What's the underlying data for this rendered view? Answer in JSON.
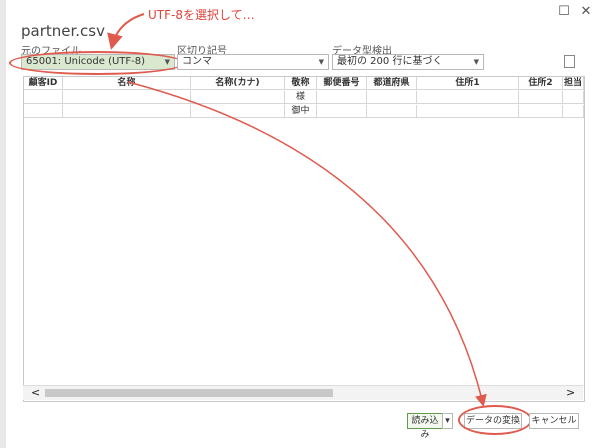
{
  "window": {
    "title": "partner.csv",
    "maximize_glyph": "☐",
    "close_glyph": "✕"
  },
  "annotation": {
    "text": "UTF-8を選択して…"
  },
  "controls": {
    "origin": {
      "label": "元のファイル",
      "value": "65001: Unicode (UTF-8)"
    },
    "delimiter": {
      "label": "区切り記号",
      "value": "コンマ"
    },
    "datatype": {
      "label": "データ型検出",
      "value": "最初の 200 行に基づく"
    }
  },
  "table": {
    "columns": [
      "顧客ID",
      "名称",
      "名称(カナ)",
      "敬称",
      "郵便番号",
      "都道府県",
      "住所1",
      "住所2",
      "担当"
    ],
    "rows": [
      [
        "",
        "",
        "",
        "様",
        "",
        "",
        "",
        "",
        ""
      ],
      [
        "",
        "",
        "",
        "御中",
        "",
        "",
        "",
        "",
        ""
      ]
    ]
  },
  "scroll": {
    "left": "<",
    "right": ">"
  },
  "buttons": {
    "load": "読み込み",
    "load_dropdown": "▾",
    "transform": "データの変換",
    "cancel": "キャンセル"
  },
  "colors": {
    "accent": "#e05a4e",
    "selected_bg": "#d9e8cf",
    "load_border": "#5e9b4a"
  }
}
